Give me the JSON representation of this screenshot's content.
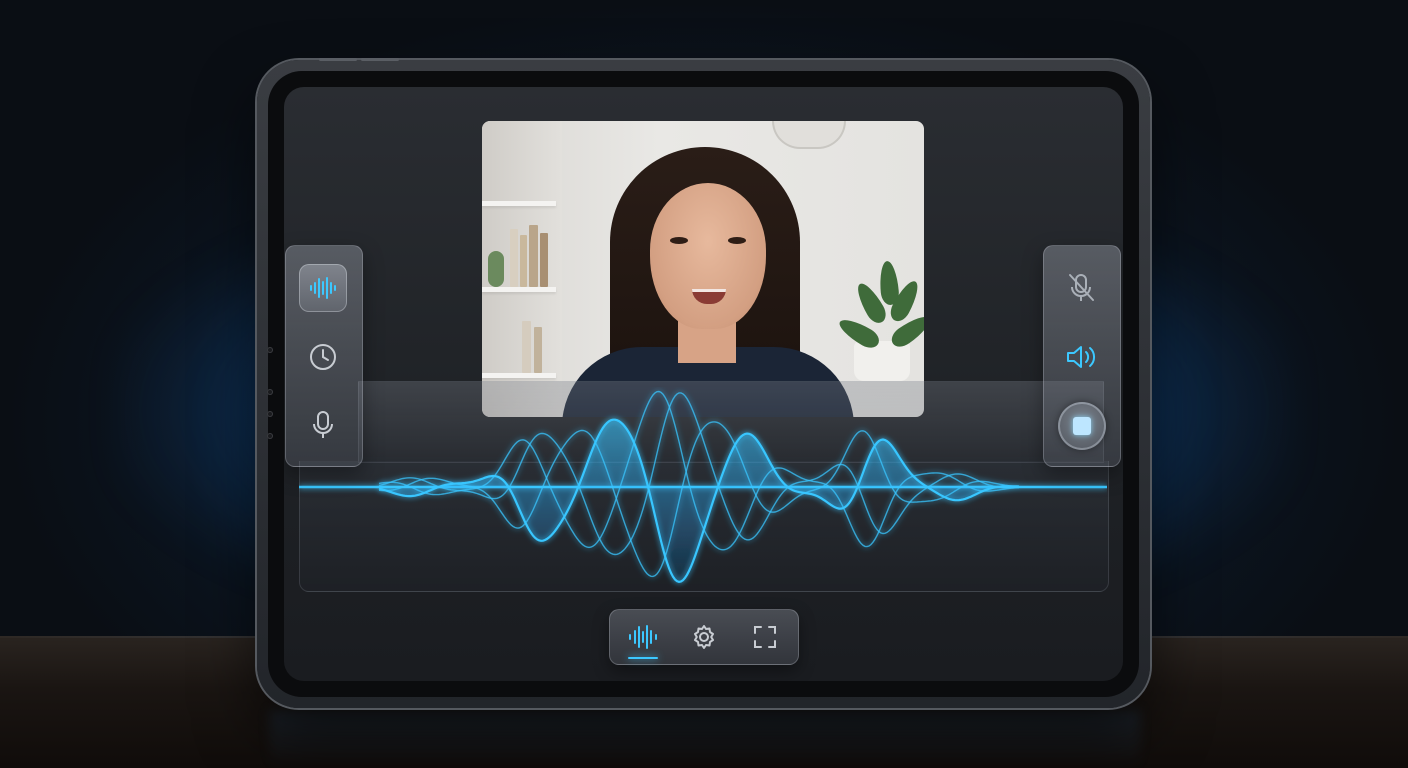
{
  "app": {
    "accent_color": "#3cc8ff",
    "screen_bg": "#1f2226"
  },
  "video_call": {
    "feed": "participant-video"
  },
  "left_panel": {
    "items": [
      {
        "icon": "waveform-icon",
        "active": true
      },
      {
        "icon": "clock-icon",
        "active": false
      },
      {
        "icon": "microphone-icon",
        "active": false
      }
    ]
  },
  "right_panel": {
    "items": [
      {
        "icon": "mic-muted-icon",
        "active": false
      },
      {
        "icon": "speaker-icon",
        "active": true
      },
      {
        "icon": "stop-icon",
        "active": false
      }
    ]
  },
  "bottom_bar": {
    "items": [
      {
        "icon": "waveform-icon",
        "active": true
      },
      {
        "icon": "gear-icon",
        "active": false
      },
      {
        "icon": "fullscreen-icon",
        "active": false
      }
    ]
  },
  "waveform": {
    "color": "#39c6ff"
  }
}
